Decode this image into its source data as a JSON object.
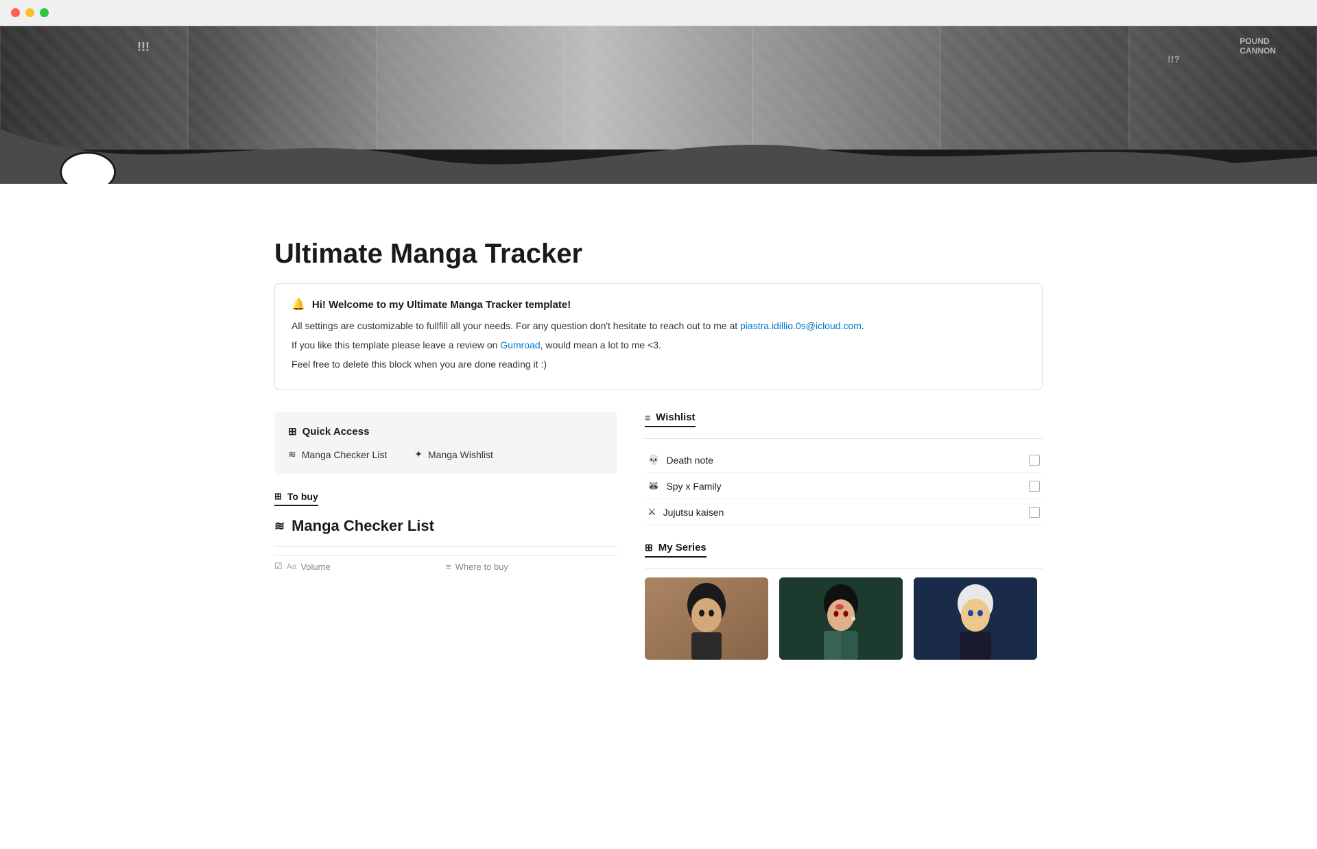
{
  "window": {
    "title": "Ultimate Manga Tracker"
  },
  "hero": {
    "wave_color": "#4a4a4a"
  },
  "page": {
    "title": "Ultimate Manga Tracker",
    "icon": "💬"
  },
  "callout": {
    "icon": "🔔",
    "title": "Hi! Welcome to my Ultimate Manga Tracker template!",
    "line1_before": "All settings are customizable to fullfill all your needs. For any question don't hesitate to reach out to me at ",
    "email": "piastra.idillio.0s@icloud.com",
    "line1_after": ".",
    "line2_before": "If you like this template please leave a review on ",
    "link_text": "Gumroad",
    "line2_after": ", would mean a lot to me <3.",
    "line3": "Feel free to delete this block when you are done reading it :)"
  },
  "quick_access": {
    "icon": "⊞",
    "label": "Quick Access",
    "link1_icon": "≡",
    "link1_label": "Manga Checker List",
    "link2_icon": "✦",
    "link2_label": "Manga Wishlist"
  },
  "to_buy": {
    "tab_icon": "⊞",
    "tab_label": "To buy",
    "section_icon": "≋",
    "section_label": "Manga Checker List",
    "col1_icon": "☑",
    "col1_label": "Volume",
    "col2_icon": "≡",
    "col2_label": "Where to buy"
  },
  "wishlist": {
    "tab_icon": "≡",
    "tab_label": "Wishlist",
    "items": [
      {
        "icon": "💀",
        "label": "Death note"
      },
      {
        "icon": "🦝",
        "label": "Spy x Family"
      },
      {
        "icon": "⚔",
        "label": "Jujutsu kaisen"
      }
    ]
  },
  "my_series": {
    "tab_icon": "⊞",
    "tab_label": "My Series",
    "cards": [
      {
        "id": "card-1",
        "bg": "card-bg-1"
      },
      {
        "id": "card-2",
        "bg": "card-bg-2"
      },
      {
        "id": "card-3",
        "bg": "card-bg-3"
      }
    ]
  }
}
